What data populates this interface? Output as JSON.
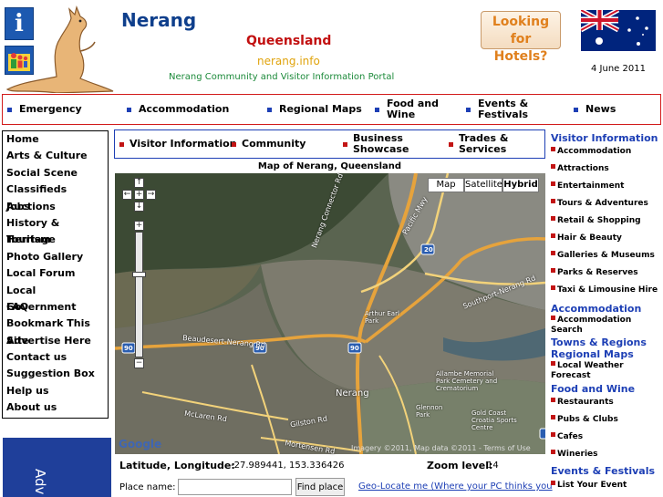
{
  "header": {
    "site_title": "Nerang",
    "state": "Queensland",
    "domain": "nerang.info",
    "tagline": "Nerang Community and Visitor Information Portal",
    "hotels_button": "Looking for Hotels?",
    "date": "4 June 2011",
    "info_icon_glyph": "i"
  },
  "top_nav": [
    "Emergency",
    "Accommodation",
    "Regional Maps",
    "Food and Wine",
    "Events & Festivals",
    "News"
  ],
  "left_menu": [
    "Home",
    "Arts & Culture",
    "Social Scene",
    "Classifieds Auctions",
    "Jobs",
    "History & Heritage",
    "Tourism",
    "Photo Gallery",
    "Local Forum",
    "Local Government",
    "FAQ",
    "Bookmark This Site",
    "Advertise Here",
    "Contact us",
    "Suggestion Box",
    "Help us",
    "About us"
  ],
  "advert_text": "Adv",
  "sub_nav": [
    "Visitor Information",
    "Community",
    "Business Showcase",
    "Trades & Services"
  ],
  "map": {
    "title": "Map of Nerang, Queensland",
    "types": [
      "Map",
      "Satellite",
      "Hybrid"
    ],
    "selected_type": "Hybrid",
    "labels": {
      "nerang": "Nerang",
      "beaudesert": "Beaudesert-Nerang Rd",
      "mclaren": "McLaren Rd",
      "gilston": "Gilston Rd",
      "mortensen": "Mortensen Rd",
      "southport": "Southport-Nerang Rd",
      "connector": "Nerang Connector Rd",
      "pacific": "Pacific Mwy",
      "arthur": "Arthur Earl Park",
      "allambe": "Allambe Memorial Park Cemetery and Crematorium",
      "glennon": "Glennon Park",
      "goldcoast": "Gold Coast Croatia Sports Centre",
      "shield_90": "90",
      "shield_20": "20"
    },
    "google_logo": "Google",
    "copyright": "Imagery ©2011, Map data ©2011 - Terms of Use"
  },
  "coords": {
    "label": "Latitude, Longitude:",
    "value": "-27.989441, 153.336426",
    "zoom_label": "Zoom level:",
    "zoom_value": "14"
  },
  "search": {
    "place_label": "Place name:",
    "place_value": "",
    "find_button": "Find place",
    "geo_link": "Geo-Locate me (Where your PC thinks you"
  },
  "right_menu": {
    "visitor_heading": "Visitor Information",
    "visitor_items": [
      "Accommodation",
      "Attractions",
      "Entertainment",
      "Tours & Adventures",
      "Retail & Shopping",
      "Hair & Beauty",
      "Galleries & Museums",
      "Parks & Reserves",
      "Taxi & Limousine Hire"
    ],
    "accommodation_heading": "Accommodation",
    "accommodation_items": [
      "Accommodation Search"
    ],
    "towns_heading": "Towns & Regions",
    "maps_heading": "Regional Maps",
    "maps_items": [
      "Local Weather Forecast"
    ],
    "food_heading": "Food and Wine",
    "food_items": [
      "Restaurants",
      "Pubs & Clubs",
      "Cafes",
      "Wineries"
    ],
    "events_heading": "Events & Festivals",
    "events_items": [
      "List Your Event"
    ]
  },
  "colors": {
    "brand_blue": "#0f3f8c",
    "link_blue": "#1d3fb5",
    "accent_red": "#c21010",
    "domain_yellow": "#e0a30c",
    "tagline_green": "#1c8a3a",
    "hotels_orange": "#e0801d"
  },
  "icons": [
    "info-icon",
    "family-icon",
    "kangaroo-logo",
    "australian-flag-icon",
    "pan-up-icon",
    "pan-left-icon",
    "pan-center-icon",
    "pan-right-icon",
    "pan-down-icon",
    "zoom-in-icon",
    "zoom-out-icon"
  ]
}
